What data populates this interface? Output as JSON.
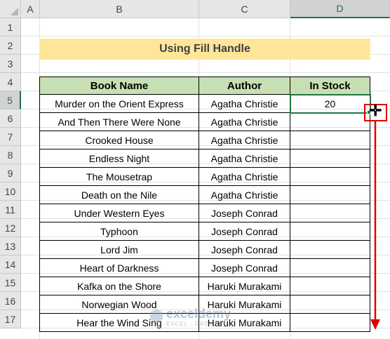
{
  "columns": [
    "A",
    "B",
    "C",
    "D"
  ],
  "rows": [
    "1",
    "2",
    "3",
    "4",
    "5",
    "6",
    "7",
    "8",
    "9",
    "10",
    "11",
    "12",
    "13",
    "14",
    "15",
    "16",
    "17"
  ],
  "title": "Using Fill Handle",
  "headers": {
    "book": "Book Name",
    "author": "Author",
    "stock": "In Stock"
  },
  "data": [
    {
      "book": "Murder on the Orient Express",
      "author": "Agatha Christie",
      "stock": "20"
    },
    {
      "book": "And Then There Were None",
      "author": "Agatha Christie",
      "stock": ""
    },
    {
      "book": "Crooked House",
      "author": "Agatha Christie",
      "stock": ""
    },
    {
      "book": "Endless Night",
      "author": "Agatha Christie",
      "stock": ""
    },
    {
      "book": "The Mousetrap",
      "author": "Agatha Christie",
      "stock": ""
    },
    {
      "book": "Death on the Nile",
      "author": "Agatha Christie",
      "stock": ""
    },
    {
      "book": "Under Western Eyes",
      "author": "Joseph Conrad",
      "stock": ""
    },
    {
      "book": "Typhoon",
      "author": "Joseph Conrad",
      "stock": ""
    },
    {
      "book": "Lord Jim",
      "author": "Joseph Conrad",
      "stock": ""
    },
    {
      "book": "Heart of Darkness",
      "author": "Joseph Conrad",
      "stock": ""
    },
    {
      "book": "Kafka on the Shore",
      "author": "Haruki Murakami",
      "stock": ""
    },
    {
      "book": "Norwegian Wood",
      "author": "Haruki Murakami",
      "stock": ""
    },
    {
      "book": "Hear the Wind Sing",
      "author": "Haruki Murakami",
      "stock": ""
    }
  ],
  "annotation": {
    "cursor_icon": "crosshair-plus-icon",
    "arrow_icon": "arrow-down-icon",
    "accent": "#e00000"
  },
  "watermark": {
    "brand": "exceldemy",
    "tagline": "EXCEL · DATA · BI"
  }
}
